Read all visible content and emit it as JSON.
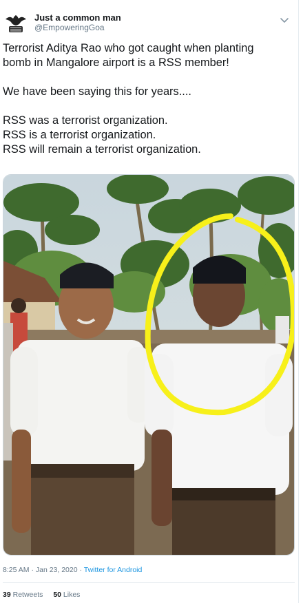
{
  "author": {
    "display_name": "Just a common man",
    "handle": "@EmpoweringGoa",
    "avatar_icon": "eagle-emblem-icon"
  },
  "tweet": {
    "lines": [
      "Terrorist Aditya Rao who got caught when planting",
      "bomb in Mangalore airport is a RSS member!",
      "",
      "We have been saying this for years....",
      "",
      "RSS was a terrorist organization.",
      "RSS is a terrorist organization.",
      "RSS will remain a terrorist organization."
    ]
  },
  "media": {
    "icons": [
      "photo-two-men-icon",
      "yellow-circle-annotation-icon"
    ]
  },
  "meta": {
    "timestamp": "8:25 AM · Jan 23, 2020",
    "separator": " · ",
    "source": "Twitter for Android"
  },
  "stats": {
    "retweets_count": "39",
    "retweets_label": "Retweets",
    "likes_count": "50",
    "likes_label": "Likes"
  },
  "colors": {
    "text": "#14171a",
    "secondary": "#657786",
    "link": "#1b95e0",
    "annotation": "#f7f01a"
  }
}
